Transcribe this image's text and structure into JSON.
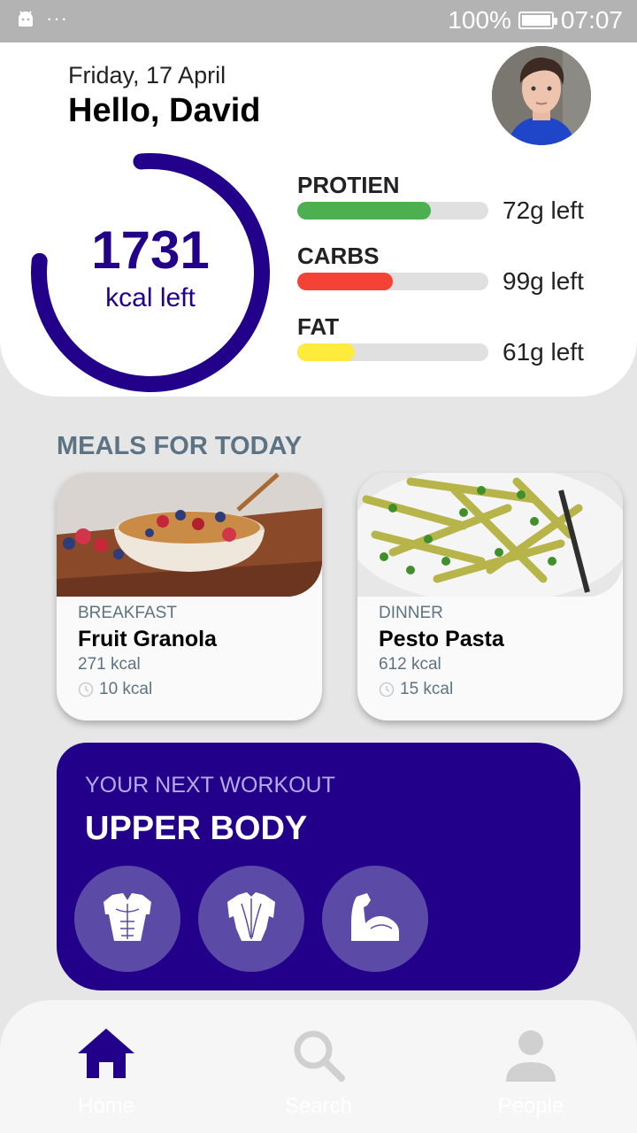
{
  "status_bar": {
    "battery": "100%",
    "time": "07:07",
    "dots": "···"
  },
  "header": {
    "date": "Friday, 17 April",
    "greeting": "Hello, David",
    "kcal_value": "1731",
    "kcal_label": "kcal left",
    "kcal_ring_fraction": 0.78,
    "ring_color": "#22008a"
  },
  "macros": [
    {
      "name": "PROTIEN",
      "left": "72g left",
      "fill": 0.7,
      "color": "#4caf50"
    },
    {
      "name": "CARBS",
      "left": "99g left",
      "fill": 0.5,
      "color": "#f44336"
    },
    {
      "name": "FAT",
      "left": "61g left",
      "fill": 0.3,
      "color": "#ffeb3b"
    }
  ],
  "meals": {
    "title": "MEALS FOR TODAY",
    "items": [
      {
        "type": "BREAKFAST",
        "name": "Fruit Granola",
        "kcal": "271 kcal",
        "time": "10 kcal"
      },
      {
        "type": "DINNER",
        "name": "Pesto Pasta",
        "kcal": "612 kcal",
        "time": "15 kcal"
      }
    ]
  },
  "workout": {
    "subtitle": "YOUR NEXT WORKOUT",
    "title": "UPPER BODY",
    "muscles": [
      "chest-icon",
      "back-icon",
      "biceps-icon"
    ]
  },
  "nav": {
    "items": [
      {
        "label": "Home",
        "icon": "home-icon",
        "active": true
      },
      {
        "label": "Search",
        "icon": "search-icon",
        "active": false
      },
      {
        "label": "People",
        "icon": "person-icon",
        "active": false
      }
    ]
  },
  "colors": {
    "accent": "#22008a",
    "muted": "#5d7383",
    "active_nav": "#22008a",
    "inactive_nav": "#d0d0d0"
  }
}
